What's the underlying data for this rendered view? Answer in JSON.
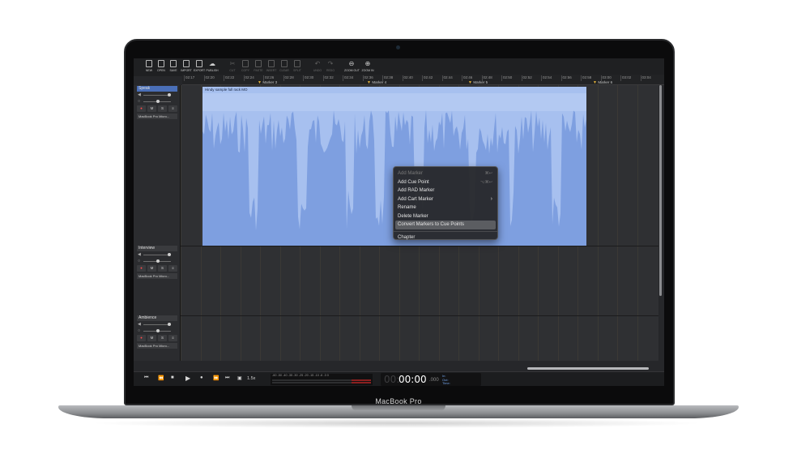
{
  "device": {
    "model_label": "MacBook Pro"
  },
  "toolbar": {
    "items": [
      {
        "label": "NEW",
        "icon": "new-file-icon",
        "enabled": true
      },
      {
        "label": "OPEN",
        "icon": "open-file-icon",
        "enabled": true
      },
      {
        "label": "SAVE",
        "icon": "save-icon",
        "enabled": true
      },
      {
        "label": "IMPORT",
        "icon": "import-icon",
        "enabled": true
      },
      {
        "label": "EXPORT",
        "icon": "export-icon",
        "enabled": true
      },
      {
        "label": "PUBLISH",
        "icon": "cloud-upload-icon",
        "enabled": true
      },
      {
        "label": "CUT",
        "icon": "scissors-icon",
        "enabled": false
      },
      {
        "label": "COPY",
        "icon": "copy-icon",
        "enabled": false
      },
      {
        "label": "PASTE",
        "icon": "paste-icon",
        "enabled": false
      },
      {
        "label": "INSERT",
        "icon": "insert-icon",
        "enabled": false
      },
      {
        "label": "CLEAR",
        "icon": "clear-icon",
        "enabled": false
      },
      {
        "label": "SPLIT",
        "icon": "split-icon",
        "enabled": false
      },
      {
        "label": "UNDO",
        "icon": "undo-icon",
        "enabled": false
      },
      {
        "label": "REDO",
        "icon": "redo-icon",
        "enabled": false
      },
      {
        "label": "ZOOM OUT",
        "icon": "zoom-out-icon",
        "enabled": true
      },
      {
        "label": "ZOOM IN",
        "icon": "zoom-in-icon",
        "enabled": true
      }
    ]
  },
  "ruler": {
    "ticks": [
      "02:17",
      "02:20",
      "02:22",
      "02:24",
      "02:26",
      "02:28",
      "02:30",
      "02:32",
      "02:34",
      "02:36",
      "02:38",
      "02:40",
      "02:42",
      "02:44",
      "02:46",
      "02:48",
      "02:50",
      "02:52",
      "02:54",
      "02:56",
      "02:58",
      "03:00",
      "03:02",
      "03:04"
    ],
    "markers": [
      "Marker 3",
      "Marker 4",
      "Marker 5",
      "Marker 6"
    ]
  },
  "tracks": [
    {
      "name": "Speak",
      "buttons": [
        "●",
        "M",
        "S",
        "≡"
      ],
      "device": "MacBook Pro Micro...",
      "selected": true
    },
    {
      "name": "Interview",
      "buttons": [
        "●",
        "M",
        "S",
        "≡"
      ],
      "device": "MacBook Pro Micro...",
      "selected": false
    },
    {
      "name": "Ambience",
      "buttons": [
        "●",
        "M",
        "S",
        "≡"
      ],
      "device": "MacBook Pro Micro...",
      "selected": false
    }
  ],
  "clip": {
    "title": "Hindy sample full rack MO",
    "color": "#a7c0ef",
    "wave_color": "#7e9fe0"
  },
  "context_menu": {
    "items": [
      {
        "label": "Add Marker",
        "shortcut": "⌘↩",
        "disabled": true
      },
      {
        "label": "Add Cue Point",
        "shortcut": "⌥⌘↩",
        "disabled": false
      },
      {
        "label": "Add RAD Marker",
        "shortcut": "",
        "disabled": false
      },
      {
        "label": "Add Cart Marker",
        "shortcut": "›",
        "disabled": false
      },
      {
        "label": "Rename",
        "shortcut": "",
        "disabled": false
      },
      {
        "label": "Delete Marker",
        "shortcut": "",
        "disabled": false
      },
      {
        "label": "Convert Markers to Cue Points",
        "shortcut": "",
        "disabled": false,
        "highlighted": true
      },
      {
        "label": "Chapter",
        "shortcut": "",
        "disabled": false,
        "separator_before": true
      }
    ]
  },
  "transport": {
    "buttons": [
      "⏮",
      "⏪",
      "■",
      "▶",
      "●",
      "⏩",
      "⏭",
      "▣"
    ],
    "speed": "1.5x",
    "meter_scale": "-60  -50  -40  -35  -30  -25  -20  -15  -10  -6  -3  0",
    "time_hours": "00:",
    "time_main": "00:00",
    "time_fraction": ".000",
    "in_label": "In:",
    "out_label": "Out:",
    "time_label": "Time:"
  }
}
